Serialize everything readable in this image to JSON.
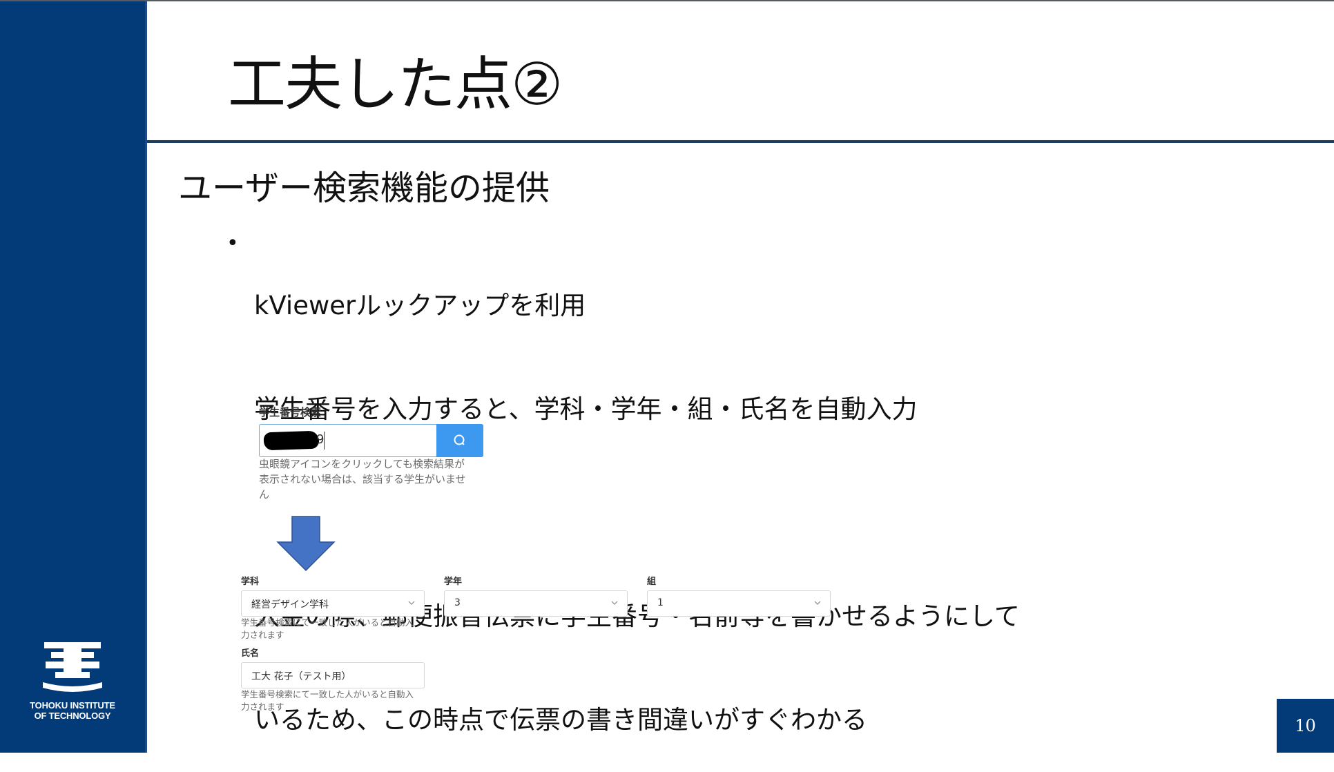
{
  "slide": {
    "title": "工夫した点②",
    "heading": "ユーザー検索機能の提供",
    "bullet_lines": [
      "kViewerルックアップを利用",
      "学生番号を入力すると、学科・学年・組・氏名を自動入力",
      "",
      "入金の際、郵便振替伝票に学生番号・名前等を書かせるようにして",
      "いるため、この時点で伝票の書き間違いがすぐわかる"
    ],
    "page_number": "10",
    "logo_text_line1": "TOHOKU INSTITUTE",
    "logo_text_line2": "OF TECHNOLOGY"
  },
  "form": {
    "search_label": "学生番号検索",
    "search_value_visible": "9",
    "search_help_lines": [
      "虫眼鏡アイコンをクリックしても検索結果が",
      "表示されない場合は、該当する学生がいませ",
      "ん"
    ],
    "department_label": "学科",
    "department_value": "経営デザイン学科",
    "department_help_lines": [
      "学生番号検索にて一致した人がいると自動入",
      "力されます"
    ],
    "grade_label": "学年",
    "grade_value": "3",
    "class_label": "組",
    "class_value": "1",
    "name_label": "氏名",
    "name_value": "工大 花子（テスト用）",
    "name_help_lines": [
      "学生番号検索にて一致した人がいると自動入",
      "力されます"
    ]
  },
  "colors": {
    "sidebar": "#033b78",
    "search_button": "#3d98f0",
    "arrow": "#4472c4"
  }
}
